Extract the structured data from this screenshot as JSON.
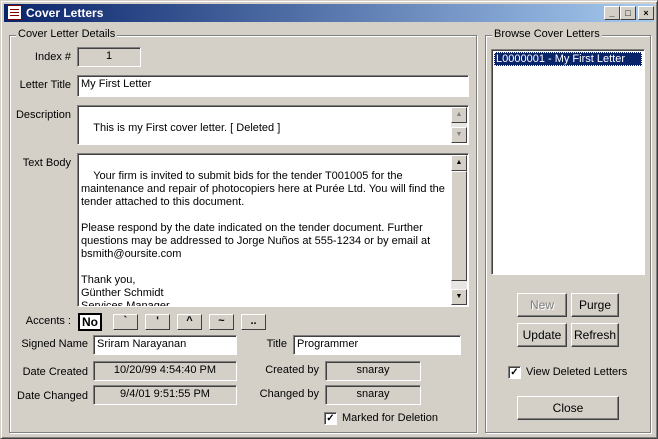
{
  "window": {
    "title": "Cover Letters",
    "minimize_glyph": "_",
    "maximize_glyph": "□",
    "close_glyph": "×"
  },
  "details": {
    "group_label": "Cover Letter Details",
    "index_label": "Index #",
    "index_value": "1",
    "letter_title_label": "Letter Title",
    "letter_title_value": "My First Letter",
    "description_label": "Description",
    "description_value": "This is my First cover letter. [ Deleted ]",
    "text_body_label": "Text Body",
    "text_body_value": "Your firm is invited to submit bids for the tender T001005 for the maintenance and repair of photocopiers here at Purée Ltd. You will find the tender attached to this document.\n\nPlease respond by the date indicated on the tender document. Further questions may be addressed to Jorge Nuños at 555-1234 or by email at bsmith@oursite.com\n\nThank you,\nGünther Schmidt\nServices Manager,",
    "accents_label": "Accents :",
    "accents": [
      "No",
      "`",
      "'",
      "^",
      "~",
      ".."
    ],
    "signed_name_label": "Signed Name",
    "signed_name_value": "Sriram Narayanan",
    "title_label": "Title",
    "title_value": "Programmer",
    "date_created_label": "Date Created",
    "date_created_value": "10/20/99 4:54:40 PM",
    "created_by_label": "Created by",
    "created_by_value": "snaray",
    "date_changed_label": "Date Changed",
    "date_changed_value": "9/4/01 9:51:55 PM",
    "changed_by_label": "Changed by",
    "changed_by_value": "snaray",
    "marked_for_deletion_label": "Marked for Deletion",
    "marked_for_deletion_checked": true
  },
  "browse": {
    "group_label": "Browse Cover Letters",
    "items": [
      "L0000001 - My First Letter"
    ],
    "selected_index": 0
  },
  "buttons": {
    "new": "New",
    "purge": "Purge",
    "update": "Update",
    "refresh": "Refresh",
    "close": "Close"
  },
  "view_deleted": {
    "label": "View Deleted Letters",
    "checked": true
  },
  "check_glyph": "✓",
  "scroll_glyphs": {
    "up": "▲",
    "down": "▼"
  }
}
